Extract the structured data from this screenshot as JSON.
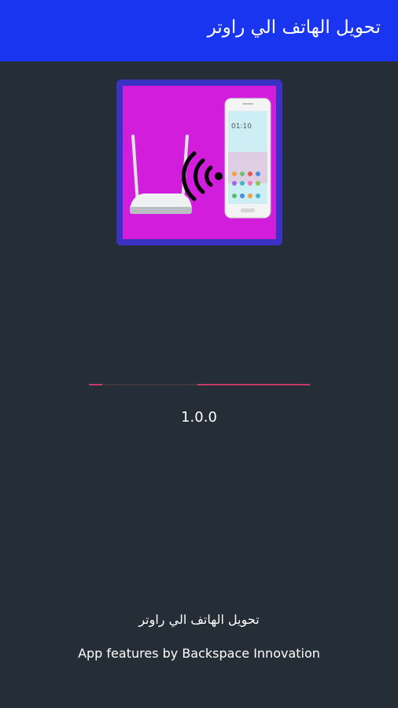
{
  "app_bar": {
    "title": "تحويل الهاتف الي راوتر",
    "color": "#1a35f0"
  },
  "app_icon": {
    "name": "router-phone-hotspot-icon",
    "background": "#d21ddd",
    "border": "#3b32c4"
  },
  "loading": {
    "progress_segments": [
      {
        "from": 0.0,
        "to": 0.06
      },
      {
        "from": 0.49,
        "to": 1.0
      }
    ],
    "color": "#c8386b"
  },
  "version": "1.0.0",
  "footer": {
    "app_name": "تحويل الهاتف الي راوتر",
    "credit": "App features by Backspace Innovation"
  }
}
